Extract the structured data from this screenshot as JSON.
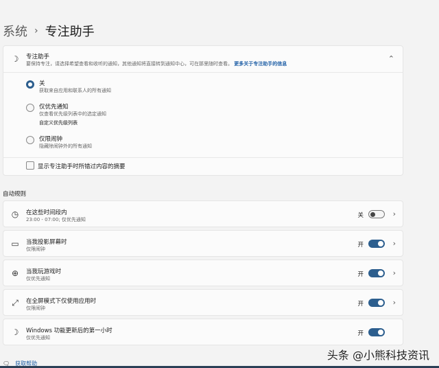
{
  "breadcrumb": {
    "parent": "系统",
    "separator": "›",
    "current": "专注助手"
  },
  "focus": {
    "title": "专注助手",
    "description": "要保持专注，请选择希望查看和收听的通知，其他通知将直接转到通知中心，可在那里随时查看。",
    "link": "更多关于专注助手的信息",
    "options": [
      {
        "label": "关",
        "desc": "获取来自应用和联系人的所有通知",
        "selected": true
      },
      {
        "label": "仅优先通知",
        "desc": "仅查看优先级列表中的选定通知",
        "link": "自定义优先级列表",
        "selected": false
      },
      {
        "label": "仅限闹钟",
        "desc": "隐藏除闹钟外的所有通知",
        "selected": false
      }
    ],
    "summary_checkbox": "显示专注助手时所错过内容的摘要"
  },
  "rules_header": "自动规则",
  "rules": [
    {
      "title": "在这些时间段内",
      "sub": "23:00 - 07:00; 仅优先通知",
      "state": "关",
      "on": false
    },
    {
      "title": "当我投影屏幕时",
      "sub": "仅限闹钟",
      "state": "开",
      "on": true
    },
    {
      "title": "当我玩游戏时",
      "sub": "仅优先通知",
      "state": "开",
      "on": true
    },
    {
      "title": "在全屏模式下仅使用应用时",
      "sub": "仅限闹钟",
      "state": "开",
      "on": true
    },
    {
      "title": "Windows 功能更新后的第一小时",
      "sub": "仅优先通知",
      "state": "开",
      "on": true
    }
  ],
  "help": "获取帮助",
  "watermark": "头条 @小熊科技资讯",
  "colors": {
    "accent": "#2c5e8e"
  }
}
